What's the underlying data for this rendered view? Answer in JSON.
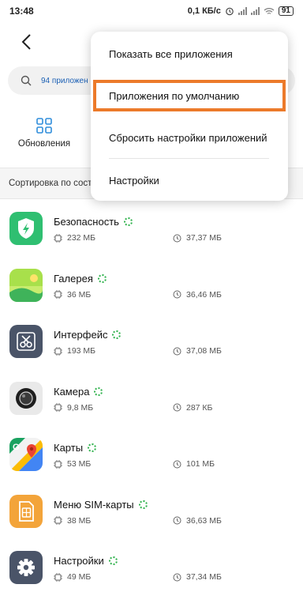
{
  "status": {
    "time": "13:48",
    "speed": "0,1 КБ/с",
    "battery": "91"
  },
  "search": {
    "placeholder": "94 приложен"
  },
  "shortcut": {
    "label": "Обновления"
  },
  "sort": {
    "label": "Сортировка по сост"
  },
  "menu": {
    "items": [
      "Показать все приложения",
      "Приложения по умолчанию",
      "Сбросить настройки приложений",
      "Настройки"
    ],
    "highlight_color": "#ec7a2a"
  },
  "apps": [
    {
      "name": "Безопасность",
      "size": "232 МБ",
      "cache": "37,37 МБ",
      "icon": "shield-icon"
    },
    {
      "name": "Галерея",
      "size": "36 МБ",
      "cache": "36,46 МБ",
      "icon": "gallery-icon"
    },
    {
      "name": "Интерфейс",
      "size": "193 МБ",
      "cache": "37,08 МБ",
      "icon": "scissors-icon"
    },
    {
      "name": "Камера",
      "size": "9,8 МБ",
      "cache": "287 КБ",
      "icon": "camera-icon"
    },
    {
      "name": "Карты",
      "size": "53 МБ",
      "cache": "101 МБ",
      "icon": "maps-icon"
    },
    {
      "name": "Меню SIM-карты",
      "size": "38 МБ",
      "cache": "36,63 МБ",
      "icon": "sim-card-icon"
    },
    {
      "name": "Настройки",
      "size": "49 МБ",
      "cache": "37,34 МБ",
      "icon": "settings-gear-icon"
    }
  ]
}
